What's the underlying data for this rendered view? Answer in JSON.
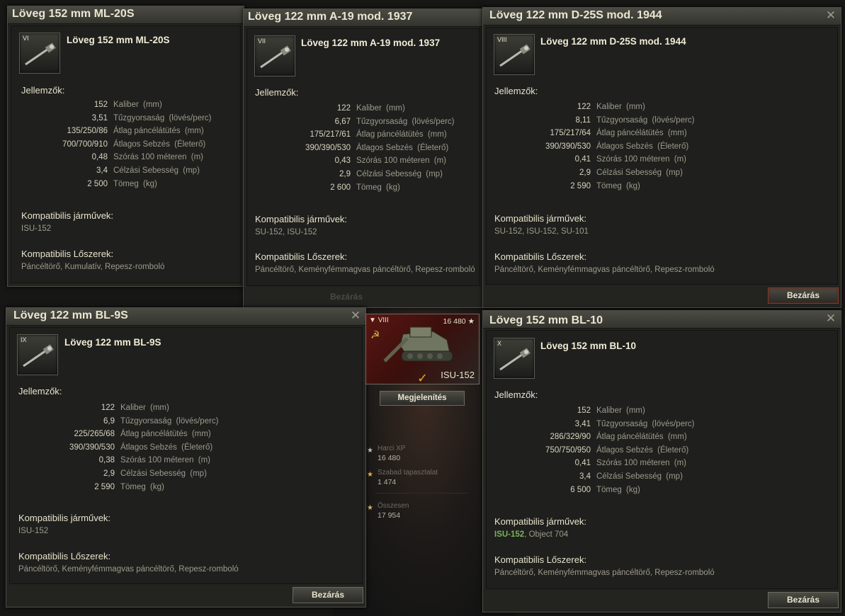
{
  "windows": [
    {
      "title": "Löveg 152 mm ML-20S",
      "gun_name": "Löveg 152 mm ML-20S",
      "tier": "VI",
      "jellemzok_label": "Jellemzők:",
      "stats": [
        {
          "value": "152",
          "label": "Kaliber",
          "unit": "(mm)"
        },
        {
          "value": "3,51",
          "label": "Tűzgyorsaság",
          "unit": "(lövés/perc)"
        },
        {
          "value": "135/250/86",
          "label": "Átlag páncélátütés",
          "unit": "(mm)"
        },
        {
          "value": "700/700/910",
          "label": "Átlagos Sebzés",
          "unit": "(Életerő)"
        },
        {
          "value": "0,48",
          "label": "Szórás 100 méteren",
          "unit": "(m)"
        },
        {
          "value": "3,4",
          "label": "Célzási Sebesség",
          "unit": "(mp)"
        },
        {
          "value": "2 500",
          "label": "Tömeg",
          "unit": "(kg)"
        }
      ],
      "vehicles_label": "Kompatibilis járművek:",
      "vehicles": "ISU-152",
      "ammo_label": "Kompatibilis Lőszerek:",
      "ammo": "Páncéltörő, Kumulatív, Repesz-romboló"
    },
    {
      "title": "Löveg 122 mm A-19 mod. 1937",
      "gun_name": "Löveg 122 mm A-19 mod. 1937",
      "tier": "VII",
      "jellemzok_label": "Jellemzők:",
      "stats": [
        {
          "value": "122",
          "label": "Kaliber",
          "unit": "(mm)"
        },
        {
          "value": "6,67",
          "label": "Tűzgyorsaság",
          "unit": "(lövés/perc)"
        },
        {
          "value": "175/217/61",
          "label": "Átlag páncélátütés",
          "unit": "(mm)"
        },
        {
          "value": "390/390/530",
          "label": "Átlagos Sebzés",
          "unit": "(Életerő)"
        },
        {
          "value": "0,43",
          "label": "Szórás 100 méteren",
          "unit": "(m)"
        },
        {
          "value": "2,9",
          "label": "Célzási Sebesség",
          "unit": "(mp)"
        },
        {
          "value": "2 600",
          "label": "Tömeg",
          "unit": "(kg)"
        }
      ],
      "vehicles_label": "Kompatibilis járművek:",
      "vehicles": "SU-152, ISU-152",
      "ammo_label": "Kompatibilis Lőszerek:",
      "ammo": "Páncéltörő, Keményfémmagvas páncéltörő, Repesz-romboló",
      "close_label": "Bezárás"
    },
    {
      "title": "Löveg 122 mm D-25S mod. 1944",
      "gun_name": "Löveg 122 mm D-25S mod. 1944",
      "tier": "VIII",
      "jellemzok_label": "Jellemzők:",
      "stats": [
        {
          "value": "122",
          "label": "Kaliber",
          "unit": "(mm)"
        },
        {
          "value": "8,11",
          "label": "Tűzgyorsaság",
          "unit": "(lövés/perc)"
        },
        {
          "value": "175/217/64",
          "label": "Átlag páncélátütés",
          "unit": "(mm)"
        },
        {
          "value": "390/390/530",
          "label": "Átlagos Sebzés",
          "unit": "(Életerő)"
        },
        {
          "value": "0,41",
          "label": "Szórás 100 méteren",
          "unit": "(m)"
        },
        {
          "value": "2,9",
          "label": "Célzási Sebesség",
          "unit": "(mp)"
        },
        {
          "value": "2 590",
          "label": "Tömeg",
          "unit": "(kg)"
        }
      ],
      "vehicles_label": "Kompatibilis járművek:",
      "vehicles": "SU-152, ISU-152, SU-101",
      "ammo_label": "Kompatibilis Lőszerek:",
      "ammo": "Páncéltörő, Keményfémmagvas páncéltörő, Repesz-romboló",
      "close_label": "Bezárás"
    },
    {
      "title": "Löveg 122 mm BL-9S",
      "gun_name": "Löveg 122 mm BL-9S",
      "tier": "IX",
      "jellemzok_label": "Jellemzők:",
      "stats": [
        {
          "value": "122",
          "label": "Kaliber",
          "unit": "(mm)"
        },
        {
          "value": "6,9",
          "label": "Tűzgyorsaság",
          "unit": "(lövés/perc)"
        },
        {
          "value": "225/265/68",
          "label": "Átlag páncélátütés",
          "unit": "(mm)"
        },
        {
          "value": "390/390/530",
          "label": "Átlagos Sebzés",
          "unit": "(Életerő)"
        },
        {
          "value": "0,38",
          "label": "Szórás 100 méteren",
          "unit": "(m)"
        },
        {
          "value": "2,9",
          "label": "Célzási Sebesség",
          "unit": "(mp)"
        },
        {
          "value": "2 590",
          "label": "Tömeg",
          "unit": "(kg)"
        }
      ],
      "vehicles_label": "Kompatibilis járművek:",
      "vehicles": "ISU-152",
      "ammo_label": "Kompatibilis Lőszerek:",
      "ammo": "Páncéltörő, Keményfémmagvas páncéltörő, Repesz-romboló",
      "close_label": "Bezárás"
    },
    {
      "title": "Löveg 152 mm BL-10",
      "gun_name": "Löveg 152 mm BL-10",
      "tier": "X",
      "jellemzok_label": "Jellemzők:",
      "stats": [
        {
          "value": "152",
          "label": "Kaliber",
          "unit": "(mm)"
        },
        {
          "value": "3,41",
          "label": "Tűzgyorsaság",
          "unit": "(lövés/perc)"
        },
        {
          "value": "286/329/90",
          "label": "Átlag páncélátütés",
          "unit": "(mm)"
        },
        {
          "value": "750/750/950",
          "label": "Átlagos Sebzés",
          "unit": "(Életerő)"
        },
        {
          "value": "0,41",
          "label": "Szórás 100 méteren",
          "unit": "(m)"
        },
        {
          "value": "3,4",
          "label": "Célzási Sebesség",
          "unit": "(mp)"
        },
        {
          "value": "6 500",
          "label": "Tömeg",
          "unit": "(kg)"
        }
      ],
      "vehicles_label": "Kompatibilis járművek:",
      "vehicles_highlight": "ISU-152",
      "vehicles_rest": ", Object 704",
      "ammo_label": "Kompatibilis Lőszerek:",
      "ammo": "Páncéltörő, Keményfémmagvas páncéltörő, Repesz-romboló",
      "close_label": "Bezárás"
    }
  ],
  "tank": {
    "tier": "VIII",
    "xp": "16 480",
    "name": "ISU-152",
    "show_button": "Megjelenítés"
  },
  "xp_panel": [
    {
      "label": "Harci XP",
      "value": "16 480"
    },
    {
      "label": "Szabad tapasztalat",
      "value": "1 474"
    },
    {
      "label": "Összesen",
      "value": "17 954"
    }
  ],
  "colors": {
    "highlight_vehicle": "#79b45a",
    "accent_check": "#f0a020",
    "window_title": "#eae6d0"
  }
}
